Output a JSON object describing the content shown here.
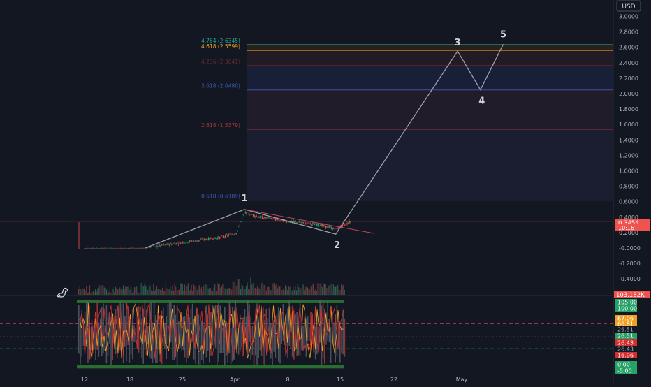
{
  "currency_label": "USD",
  "price_axis_ticks": [
    "3.0000",
    "2.8000",
    "2.6000",
    "2.4000",
    "2.2000",
    "2.0000",
    "1.8000",
    "1.6000",
    "1.4000",
    "1.2000",
    "1.0000",
    "0.8000",
    "0.6000",
    "0.4000",
    "0.2000",
    "-0.0000",
    "-0.2000",
    "-0.4000"
  ],
  "last_price": "0.3454",
  "countdown": "10:16",
  "volume_badge": "103.182K",
  "oscillator_badges": [
    {
      "text": "105.00",
      "value": 105,
      "color": "#26a269"
    },
    {
      "text": "100.00",
      "value": 100,
      "color": "#26a269"
    },
    {
      "text": "67.06",
      "value": 67.06,
      "color": "#f0a020"
    },
    {
      "text": "66.81",
      "value": 66.81,
      "color": "#f0a020"
    },
    {
      "text": "26.51",
      "value": 26.51,
      "color": "#131722"
    },
    {
      "text": "26.51",
      "value": 26.51,
      "color": "#26a269"
    },
    {
      "text": "26.43",
      "value": 26.43,
      "color": "#d32f2f"
    },
    {
      "text": "26.43",
      "value": 26.43,
      "color": "#131722"
    },
    {
      "text": "16.96",
      "value": 16.96,
      "color": "#d32f2f"
    },
    {
      "text": "0.00",
      "value": 0,
      "color": "#26a269"
    },
    {
      "text": "-5.00",
      "value": -5,
      "color": "#26a269"
    }
  ],
  "time_axis_labels": [
    "12",
    "18",
    "25",
    "Apr",
    "8",
    "15",
    "22",
    "May"
  ],
  "colors": {
    "background": "#131722",
    "wave": "#9aa0ab",
    "text": "#b2b5be",
    "bull": "#26a269",
    "bear": "#ef5350"
  },
  "chart_data": {
    "type": "line",
    "title": "",
    "y_axis": {
      "label": "USD",
      "range": [
        -0.45,
        3.1
      ],
      "scale": "linear"
    },
    "x_axis": {
      "tick_labels": [
        "12",
        "18",
        "25",
        "Apr",
        "8",
        "15",
        "22",
        "May"
      ]
    },
    "price_series": {
      "name": "",
      "x": [
        "Mar 12",
        "Mar 20",
        "Mar 24",
        "Mar 27",
        "Mar 30",
        "Apr 1",
        "Apr 2",
        "Apr 4",
        "Apr 6",
        "Apr 9",
        "Apr 12",
        "Apr 14",
        "Apr 15",
        "Apr 16"
      ],
      "y": [
        0.0,
        0.0,
        0.06,
        0.1,
        0.14,
        0.2,
        0.46,
        0.4,
        0.37,
        0.33,
        0.3,
        0.24,
        0.29,
        0.3454
      ]
    },
    "elliott_wave": {
      "points": [
        {
          "label": "",
          "x": "Mar 20",
          "y": 0.0
        },
        {
          "label": "1",
          "x": "Apr 2",
          "y": 0.5
        },
        {
          "label": "2",
          "x": "Apr 14",
          "y": 0.18
        },
        {
          "label": "3",
          "x": "Apr 30",
          "y": 2.55
        },
        {
          "label": "4",
          "x": "May 3",
          "y": 2.05
        },
        {
          "label": "5",
          "x": "May 6",
          "y": 2.64
        }
      ]
    },
    "trendline": {
      "from": {
        "x": "Apr 2",
        "y": 0.5
      },
      "to": {
        "x": "Apr 19",
        "y": 0.19
      }
    },
    "fibonacci_extension": [
      {
        "text": "0.618 (0.6189)",
        "level": 0.6189,
        "color": "#3b5bb5"
      },
      {
        "text": "2.618 (1.5379)",
        "level": 1.5379,
        "color": "#a8343a"
      },
      {
        "text": "3.618 (2.0480)",
        "level": 2.048,
        "color": "#3b5bb5"
      },
      {
        "text": "4.236 (2.3641)",
        "level": 2.3641,
        "color": "#6b2a30"
      },
      {
        "text": "4.618 (2.5599)",
        "level": 2.5599,
        "color": "#f0a020"
      },
      {
        "text": "4.764 (2.6345)",
        "level": 2.6345,
        "color": "#26a69a"
      }
    ],
    "oscillator_levels": [
      105,
      100,
      67.06,
      26.51,
      0,
      -5
    ],
    "oscillator_range": [
      -8,
      110
    ],
    "grid": false,
    "legend": "none"
  }
}
